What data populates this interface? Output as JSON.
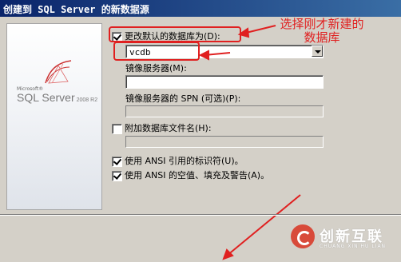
{
  "window": {
    "title": "创建到 SQL Server 的新数据源"
  },
  "logo": {
    "vendor": "Microsoft®",
    "product": "SQL Server",
    "version": "2008 R2"
  },
  "form": {
    "change_default_db": {
      "label": "更改默认的数据库为(D):",
      "checked": true
    },
    "default_db_value": "vcdb",
    "mirror_server": {
      "label": "镜像服务器(M):",
      "value": ""
    },
    "mirror_spn": {
      "label": "镜像服务器的 SPN (可选)(P):",
      "value": ""
    },
    "attach_db_filename": {
      "label": "附加数据库文件名(H):",
      "checked": false,
      "value": ""
    },
    "ansi_quoted": {
      "label": "使用 ANSI 引用的标识符(U)。",
      "checked": true
    },
    "ansi_nulls": {
      "label": "使用 ANSI 的空值、填充及警告(A)。",
      "checked": true
    }
  },
  "annotation": {
    "text_line1": "选择刚才新建的",
    "text_line2": "数据库",
    "color": "#e02020"
  },
  "watermark": {
    "name": "创新互联",
    "sub": "CHUANG XIN HU LIAN"
  }
}
